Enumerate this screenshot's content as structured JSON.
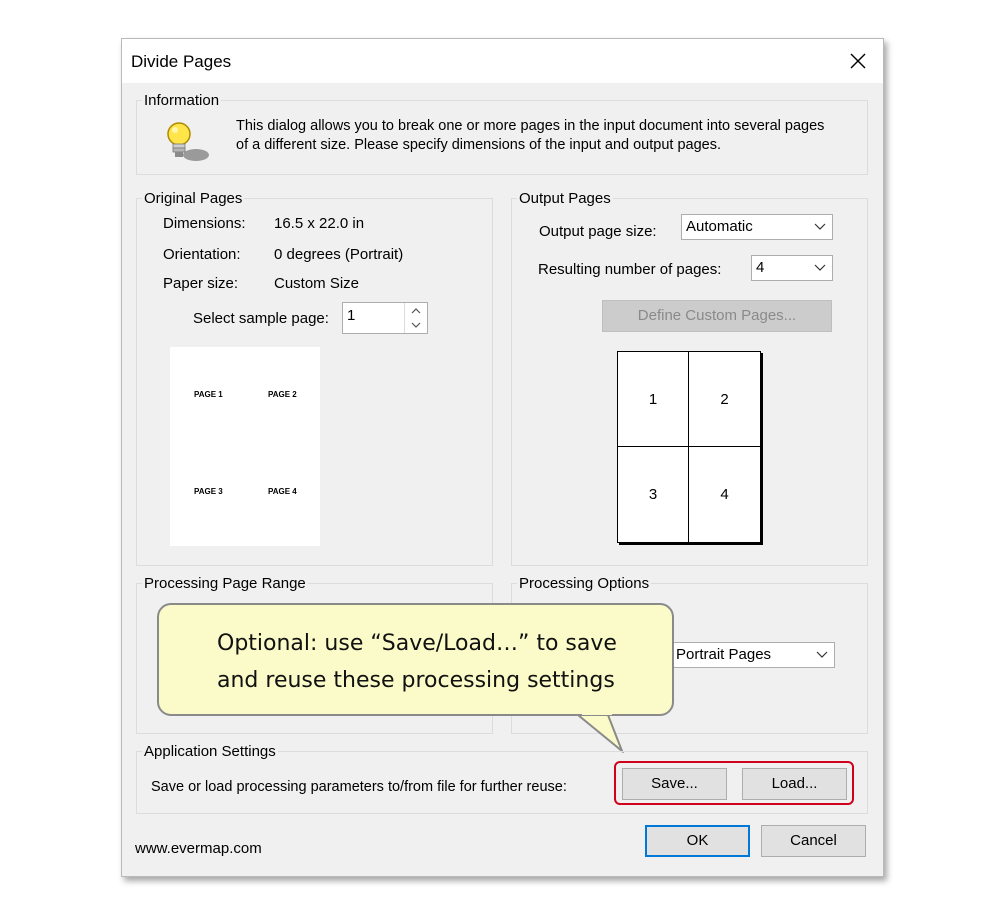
{
  "dialog": {
    "title": "Divide Pages",
    "close_icon": "close-icon"
  },
  "information": {
    "title": "Information",
    "icon": "lightbulb-icon",
    "line1": "This dialog allows you to break one or more pages in the input document into several pages",
    "line2": "of a different size. Please specify dimensions of the input and output pages."
  },
  "original_pages": {
    "title": "Original Pages",
    "dimensions_label": "Dimensions:",
    "dimensions_value": "16.5 x 22.0 in",
    "orientation_label": "Orientation:",
    "orientation_value": "0 degrees (Portrait)",
    "paper_size_label": "Paper size:",
    "paper_size_value": "Custom Size",
    "sample_page_label": "Select sample page:",
    "sample_page_value": "1",
    "thumb_labels": [
      "PAGE 1",
      "PAGE 2",
      "PAGE 3",
      "PAGE 4"
    ]
  },
  "output_pages": {
    "title": "Output Pages",
    "page_size_label": "Output page size:",
    "page_size_value": "Automatic",
    "num_pages_label": "Resulting number of pages:",
    "num_pages_value": "4",
    "define_custom_label": "Define Custom Pages...",
    "grid_labels": [
      "1",
      "2",
      "3",
      "4"
    ]
  },
  "processing_range": {
    "title": "Processing Page Range"
  },
  "processing_options": {
    "title": "Processing Options",
    "select_value": "Portrait Pages"
  },
  "callout": {
    "line1": "Optional: use “Save/Load…” to save",
    "line2": "and reuse these processing settings"
  },
  "application_settings": {
    "title": "Application Settings",
    "description": "Save or load processing parameters to/from file for further reuse:",
    "save_label": "Save...",
    "load_label": "Load..."
  },
  "footer": {
    "website": "www.evermap.com",
    "ok_label": "OK",
    "cancel_label": "Cancel"
  },
  "colors": {
    "highlight_border": "#d0021b",
    "callout_fill": "#fbfbc9",
    "default_button_border": "#0078d7"
  }
}
